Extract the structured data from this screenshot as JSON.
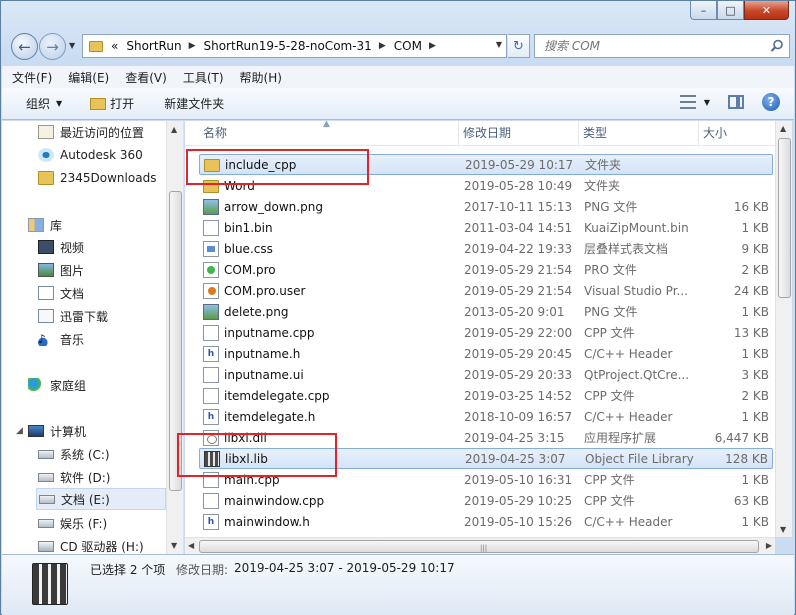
{
  "window": {
    "minimize": "–",
    "maximize": "□",
    "close": "✕"
  },
  "nav": {
    "back_icon": "back-arrow-icon",
    "forward_icon": "forward-arrow-icon"
  },
  "address": {
    "overflow": "«",
    "crumbs": [
      "ShortRun",
      "ShortRun19-5-28-noCom-31",
      "COM"
    ]
  },
  "search": {
    "placeholder": "搜索 COM"
  },
  "menu": [
    "文件(F)",
    "编辑(E)",
    "查看(V)",
    "工具(T)",
    "帮助(H)"
  ],
  "toolbar": {
    "organize": "组织",
    "open": "打开",
    "new_folder": "新建文件夹"
  },
  "navpane": {
    "recent": "最近访问的位置",
    "autodesk": "Autodesk 360",
    "downloads": "2345Downloads",
    "libraries": "库",
    "videos": "视频",
    "pictures": "图片",
    "documents": "文档",
    "xunlei": "迅雷下载",
    "music": "音乐",
    "homegroup": "家庭组",
    "computer": "计算机",
    "drive_c": "系统 (C:)",
    "drive_d": "软件 (D:)",
    "drive_e": "文档 (E:)",
    "drive_f": "娱乐 (F:)",
    "drive_h": "CD 驱动器 (H:)"
  },
  "columns": {
    "name": "名称",
    "modified": "修改日期",
    "type": "类型",
    "size": "大小"
  },
  "files": [
    {
      "name": "include_cpp",
      "date": "2019-05-29 10:17",
      "type": "文件夹",
      "size": "",
      "icon": "folder-icon",
      "selected": true
    },
    {
      "name": "Word",
      "date": "2019-05-28 10:49",
      "type": "文件夹",
      "size": "",
      "icon": "folder-icon",
      "selected": false
    },
    {
      "name": "arrow_down.png",
      "date": "2017-10-11 15:13",
      "type": "PNG 文件",
      "size": "16 KB",
      "icon": "png-icon",
      "selected": false
    },
    {
      "name": "bin1.bin",
      "date": "2011-03-04 14:51",
      "type": "KuaiZipMount.bin",
      "size": "1 KB",
      "icon": "file-icon",
      "selected": false
    },
    {
      "name": "blue.css",
      "date": "2019-04-22 19:33",
      "type": "层叠样式表文档",
      "size": "9 KB",
      "icon": "css-icon",
      "selected": false
    },
    {
      "name": "COM.pro",
      "date": "2019-05-29 21:54",
      "type": "PRO 文件",
      "size": "2 KB",
      "icon": "pro-icon",
      "selected": false
    },
    {
      "name": "COM.pro.user",
      "date": "2019-05-29 21:54",
      "type": "Visual Studio Pr...",
      "size": "24 KB",
      "icon": "prouser-icon",
      "selected": false
    },
    {
      "name": "delete.png",
      "date": "2013-05-20 9:01",
      "type": "PNG 文件",
      "size": "1 KB",
      "icon": "png-icon",
      "selected": false
    },
    {
      "name": "inputname.cpp",
      "date": "2019-05-29 22:00",
      "type": "CPP 文件",
      "size": "13 KB",
      "icon": "cpp-icon",
      "selected": false
    },
    {
      "name": "inputname.h",
      "date": "2019-05-29 20:45",
      "type": "C/C++ Header",
      "size": "1 KB",
      "icon": "header-icon",
      "selected": false
    },
    {
      "name": "inputname.ui",
      "date": "2019-05-29 20:33",
      "type": "QtProject.QtCre...",
      "size": "3 KB",
      "icon": "ui-icon",
      "selected": false
    },
    {
      "name": "itemdelegate.cpp",
      "date": "2019-03-25 14:52",
      "type": "CPP 文件",
      "size": "2 KB",
      "icon": "cpp-icon",
      "selected": false
    },
    {
      "name": "itemdelegate.h",
      "date": "2018-10-09 16:57",
      "type": "C/C++ Header",
      "size": "1 KB",
      "icon": "header-icon",
      "selected": false
    },
    {
      "name": "libxl.dll",
      "date": "2019-04-25 3:15",
      "type": "应用程序扩展",
      "size": "6,447 KB",
      "icon": "dll-icon",
      "selected": false
    },
    {
      "name": "libxl.lib",
      "date": "2019-04-25 3:07",
      "type": "Object File Library",
      "size": "128 KB",
      "icon": "lib-icon",
      "selected": true
    },
    {
      "name": "main.cpp",
      "date": "2019-05-10 16:31",
      "type": "CPP 文件",
      "size": "1 KB",
      "icon": "cpp-icon",
      "selected": false
    },
    {
      "name": "mainwindow.cpp",
      "date": "2019-05-29 10:25",
      "type": "CPP 文件",
      "size": "63 KB",
      "icon": "cpp-icon",
      "selected": false
    },
    {
      "name": "mainwindow.h",
      "date": "2019-05-10 15:26",
      "type": "C/C++ Header",
      "size": "1 KB",
      "icon": "header-icon",
      "selected": false
    }
  ],
  "details": {
    "selection": "已选择 2 个项",
    "modified_label": "修改日期:",
    "modified_value": "2019-04-25 3:07 - 2019-05-29 10:17"
  },
  "colors": {
    "highlight_box": "#e0242c",
    "selection": "#d3e3f7"
  }
}
